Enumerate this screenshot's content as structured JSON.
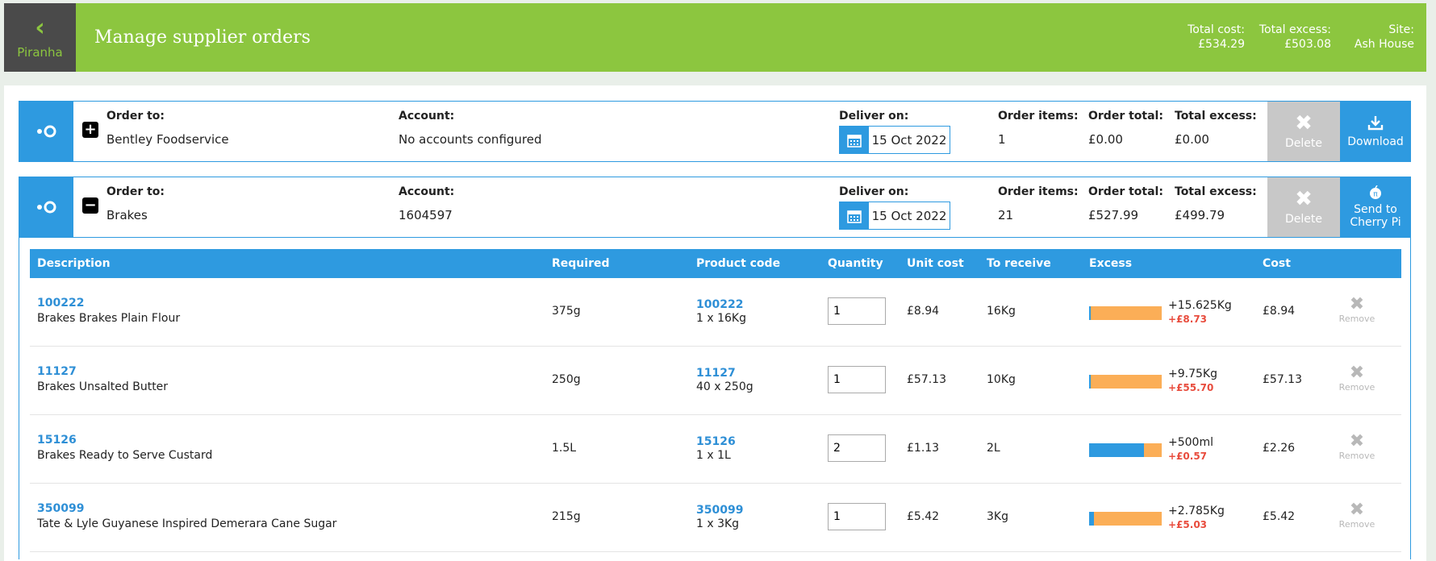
{
  "header": {
    "back_label": "Piranha",
    "title": "Manage supplier orders",
    "total_cost_label": "Total cost:",
    "total_cost_value": "£534.29",
    "total_excess_label": "Total excess:",
    "total_excess_value": "£503.08",
    "site_label": "Site:",
    "site_value": "Ash House"
  },
  "labels": {
    "order_to": "Order to:",
    "account": "Account:",
    "deliver_on": "Deliver on:",
    "order_items": "Order items:",
    "order_total": "Order total:",
    "total_excess": "Total excess:",
    "delete": "Delete",
    "download": "Download",
    "send_to": "Send to Cherry Pi",
    "remove": "Remove"
  },
  "orders": [
    {
      "supplier": "Bentley Foodservice",
      "account": "No accounts configured",
      "deliver_on": "15 Oct 2022",
      "order_items": "1",
      "order_total": "£0.00",
      "total_excess": "£0.00",
      "toggle": "+"
    },
    {
      "supplier": "Brakes",
      "account": "1604597",
      "deliver_on": "15 Oct 2022",
      "order_items": "21",
      "order_total": "£527.99",
      "total_excess": "£499.79",
      "toggle": "−"
    }
  ],
  "table": {
    "headers": [
      "Description",
      "Required",
      "Product code",
      "Quantity",
      "Unit cost",
      "To receive",
      "Excess",
      "Cost"
    ],
    "rows": [
      {
        "code": "100222",
        "name": "Brakes Brakes Plain Flour",
        "required": "375g",
        "pcode": "100222",
        "pack": "1 x 16Kg",
        "qty": "1",
        "unit_cost": "£8.94",
        "receive": "16Kg",
        "excess_fraction": 0.02,
        "excess_amt": "+15.625Kg",
        "excess_cost": "+£8.73",
        "cost": "£8.94"
      },
      {
        "code": "11127",
        "name": "Brakes Unsalted Butter",
        "required": "250g",
        "pcode": "11127",
        "pack": "40 x 250g",
        "qty": "1",
        "unit_cost": "£57.13",
        "receive": "10Kg",
        "excess_fraction": 0.025,
        "excess_amt": "+9.75Kg",
        "excess_cost": "+£55.70",
        "cost": "£57.13"
      },
      {
        "code": "15126",
        "name": "Brakes Ready to Serve Custard",
        "required": "1.5L",
        "pcode": "15126",
        "pack": "1 x 1L",
        "qty": "2",
        "unit_cost": "£1.13",
        "receive": "2L",
        "excess_fraction": 0.75,
        "excess_amt": "+500ml",
        "excess_cost": "+£0.57",
        "cost": "£2.26"
      },
      {
        "code": "350099",
        "name": "Tate & Lyle Guyanese Inspired Demerara Cane Sugar",
        "required": "215g",
        "pcode": "350099",
        "pack": "1 x 3Kg",
        "qty": "1",
        "unit_cost": "£5.42",
        "receive": "3Kg",
        "excess_fraction": 0.07,
        "excess_amt": "+2.785Kg",
        "excess_cost": "+£5.03",
        "cost": "£5.42"
      }
    ]
  }
}
